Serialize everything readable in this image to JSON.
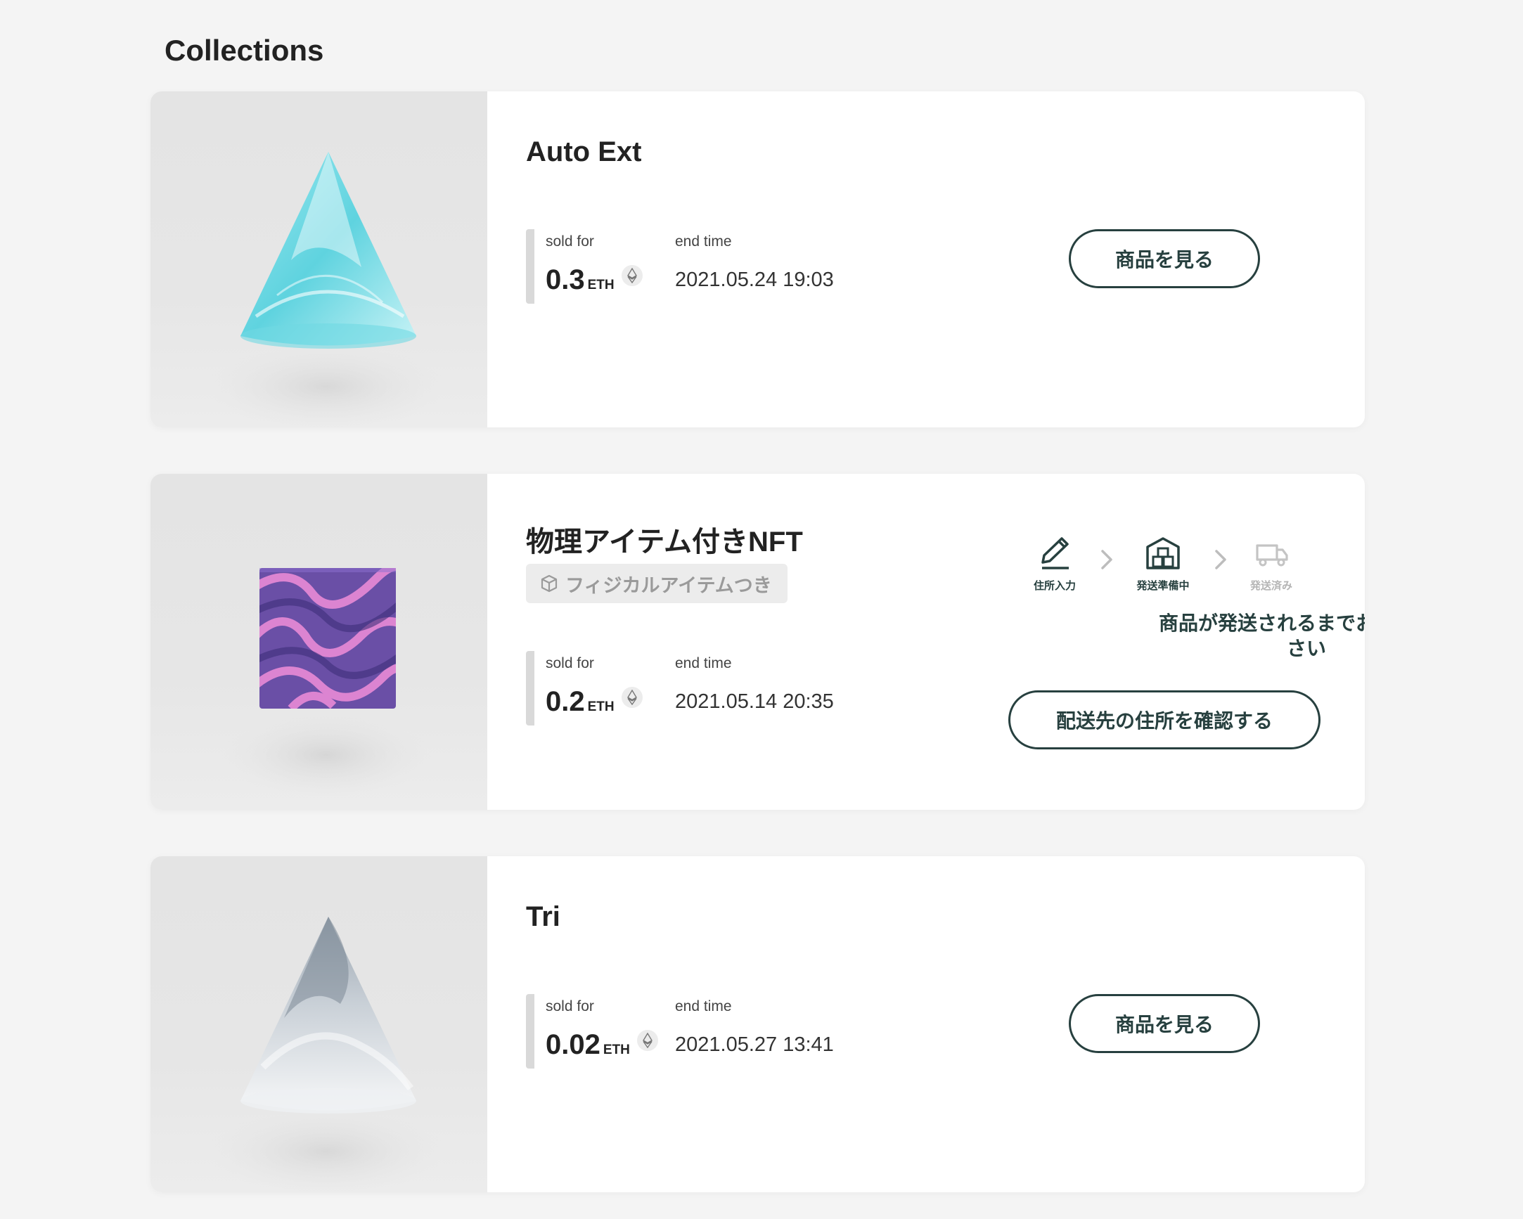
{
  "page": {
    "title": "Collections"
  },
  "labels": {
    "sold_for": "sold for",
    "end_time": "end time",
    "currency": "ETH"
  },
  "colors": {
    "accent": "#27403f",
    "muted": "#b5b5b5",
    "card_bg": "#ffffff",
    "page_bg": "#f4f4f4"
  },
  "items": [
    {
      "title": "Auto Ext",
      "price": "0.3",
      "end_time": "2021.05.24 19:03",
      "button_label": "商品を見る",
      "image_icon": "cone-cyan-marble"
    },
    {
      "title": "物理アイテム付きNFT",
      "badge": "フィジカルアイテムつき",
      "badge_icon": "box-icon",
      "price": "0.2",
      "end_time": "2021.05.14 20:35",
      "image_icon": "cube-purple-swirl",
      "shipping_steps": [
        {
          "label": "住所入力",
          "icon": "pencil-icon",
          "state": "done"
        },
        {
          "label": "発送準備中",
          "icon": "warehouse-icon",
          "state": "active"
        },
        {
          "label": "発送済み",
          "icon": "truck-icon",
          "state": "pending"
        }
      ],
      "wait_message": "商品が発送されるまでお待ちください",
      "button_label": "配送先の住所を確認する"
    },
    {
      "title": "Tri",
      "price": "0.02",
      "end_time": "2021.05.27 13:41",
      "button_label": "商品を見る",
      "image_icon": "cone-white-marble"
    }
  ]
}
